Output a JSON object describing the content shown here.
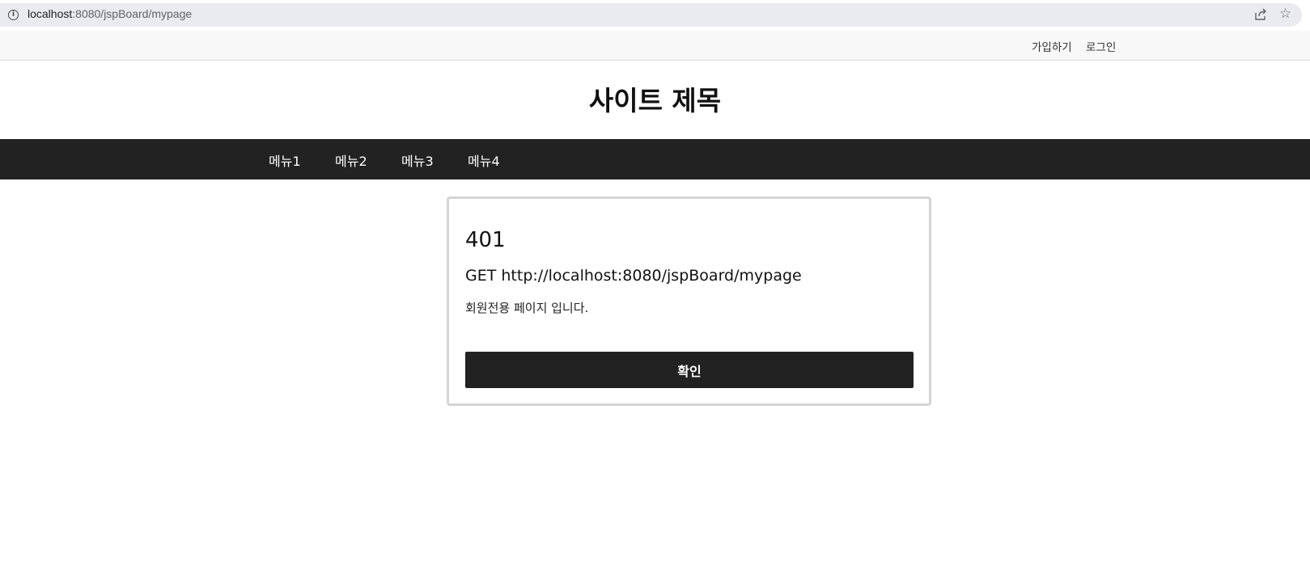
{
  "browser": {
    "url_host": "localhost",
    "url_rest": ":8080/jspBoard/mypage",
    "info_icon": "info-icon",
    "share_icon": "share-icon",
    "star_icon": "star-icon"
  },
  "top_bar": {
    "join_label": "가입하기",
    "login_label": "로그인"
  },
  "site": {
    "title": "사이트 제목"
  },
  "nav": {
    "items": [
      {
        "label": "메뉴1"
      },
      {
        "label": "메뉴2"
      },
      {
        "label": "메뉴3"
      },
      {
        "label": "메뉴4"
      }
    ]
  },
  "error": {
    "code": "401",
    "request": "GET http://localhost:8080/jspBoard/mypage",
    "message": "회원전용 페이지 입니다.",
    "confirm_label": "확인"
  },
  "colors": {
    "nav_background": "#222222",
    "button_background": "#222222",
    "card_border": "#d4d4d4"
  }
}
